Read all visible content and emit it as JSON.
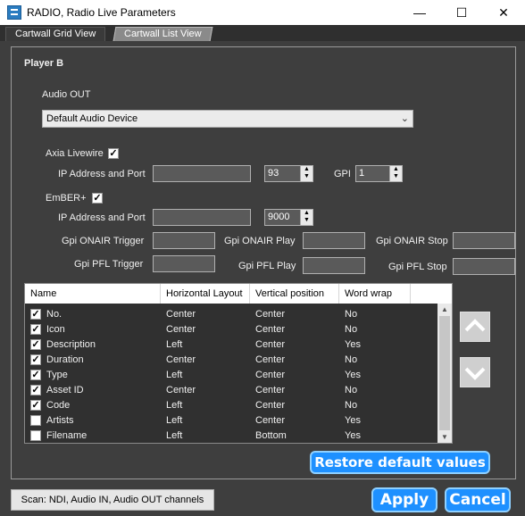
{
  "window": {
    "title": "RADIO, Radio Live Parameters",
    "minimize": "—",
    "maximize": "☐",
    "close": "✕"
  },
  "tabs": [
    {
      "label": "Cartwall Grid View"
    },
    {
      "label": "Cartwall List View"
    }
  ],
  "player": {
    "title": "Player B"
  },
  "audio_out": {
    "label": "Audio OUT",
    "value": "Default Audio Device"
  },
  "axia": {
    "label": "Axia Livewire",
    "checked": true,
    "ip_label": "IP Address and Port",
    "ip_value": "",
    "port_value": "93",
    "gpi_label": "GPI",
    "gpi_value": "1"
  },
  "ember": {
    "label": "EmBER+",
    "checked": true,
    "ip_label": "IP Address and Port",
    "ip_value": "",
    "port_value": "9000"
  },
  "gpi": {
    "onair_trigger": "Gpi ONAIR Trigger",
    "onair_play": "Gpi ONAIR Play",
    "onair_stop": "Gpi ONAIR Stop",
    "pfl_trigger": "Gpi PFL Trigger",
    "pfl_play": "Gpi PFL Play",
    "pfl_stop": "Gpi PFL Stop"
  },
  "table": {
    "columns": [
      "Name",
      "Horizontal Layout",
      "Vertical position",
      "Word wrap"
    ],
    "rows": [
      {
        "checked": true,
        "name": "No.",
        "horizontal": "Center",
        "vertical": "Center",
        "wrap": "No"
      },
      {
        "checked": true,
        "name": "Icon",
        "horizontal": "Center",
        "vertical": "Center",
        "wrap": "No"
      },
      {
        "checked": true,
        "name": "Description",
        "horizontal": "Left",
        "vertical": "Center",
        "wrap": "Yes"
      },
      {
        "checked": true,
        "name": "Duration",
        "horizontal": "Center",
        "vertical": "Center",
        "wrap": "No"
      },
      {
        "checked": true,
        "name": "Type",
        "horizontal": "Left",
        "vertical": "Center",
        "wrap": "Yes"
      },
      {
        "checked": true,
        "name": "Asset ID",
        "horizontal": "Center",
        "vertical": "Center",
        "wrap": "No"
      },
      {
        "checked": true,
        "name": "Code",
        "horizontal": "Left",
        "vertical": "Center",
        "wrap": "No"
      },
      {
        "checked": false,
        "name": "Artists",
        "horizontal": "Left",
        "vertical": "Center",
        "wrap": "Yes"
      },
      {
        "checked": false,
        "name": "Filename",
        "horizontal": "Left",
        "vertical": "Bottom",
        "wrap": "Yes"
      }
    ]
  },
  "buttons": {
    "restore": "Restore default values",
    "scan": "Scan: NDI, Audio IN, Audio OUT channels",
    "apply": "Apply",
    "cancel": "Cancel"
  },
  "icons": {
    "move_up": "chevron-up-icon",
    "move_down": "chevron-down-icon"
  },
  "colors": {
    "accent": "#1e90ff",
    "background": "#3e3e3e",
    "table_bg": "#303030"
  }
}
